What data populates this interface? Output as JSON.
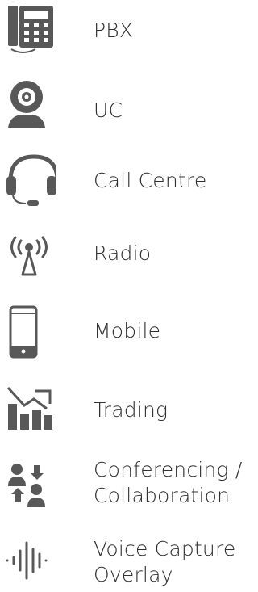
{
  "colors": {
    "icon": "#585858",
    "text": "#2f2f2f",
    "background": "#ffffff"
  },
  "items": [
    {
      "icon": "desk-phone-icon",
      "label": "PBX"
    },
    {
      "icon": "webcam-icon",
      "label": "UC"
    },
    {
      "icon": "headset-icon",
      "label": "Call Centre"
    },
    {
      "icon": "radio-antenna-icon",
      "label": "Radio"
    },
    {
      "icon": "mobile-phone-icon",
      "label": "Mobile"
    },
    {
      "icon": "trading-chart-icon",
      "label": "Trading"
    },
    {
      "icon": "conference-people-icon",
      "label_line1": "Conferencing /",
      "label_line2": "Collaboration"
    },
    {
      "icon": "voice-waveform-icon",
      "label_line1": "Voice Capture",
      "label_line2": "Overlay"
    }
  ]
}
